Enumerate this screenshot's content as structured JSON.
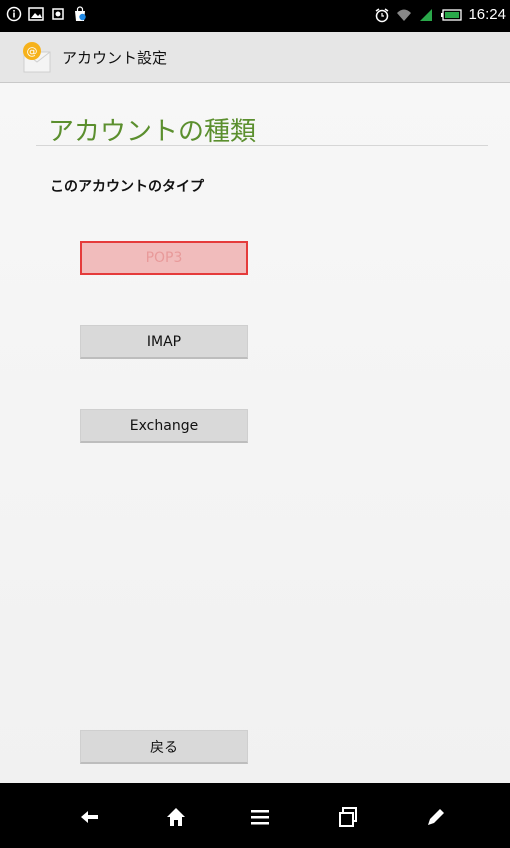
{
  "status_bar": {
    "time": "16:24",
    "icons_left": [
      "info-icon",
      "image-icon",
      "record-icon",
      "store-icon"
    ],
    "icons_right": [
      "alarm-icon",
      "wifi-icon",
      "signal-icon",
      "battery-icon"
    ]
  },
  "action_bar": {
    "title": "アカウント設定",
    "app_icon": "email-icon"
  },
  "page": {
    "title": "アカウントの種類",
    "subtitle": "このアカウントのタイプ"
  },
  "options": {
    "pop3": "POP3",
    "imap": "IMAP",
    "exchange": "Exchange"
  },
  "back_button": "戻る",
  "nav_bar": {
    "icons": [
      "back-icon",
      "home-icon",
      "menu-icon",
      "recent-apps-icon",
      "pen-icon"
    ]
  },
  "colors": {
    "title_green": "#5b8f2e",
    "selected_border": "#e53b3b",
    "selected_fill": "#f1bcbc"
  }
}
